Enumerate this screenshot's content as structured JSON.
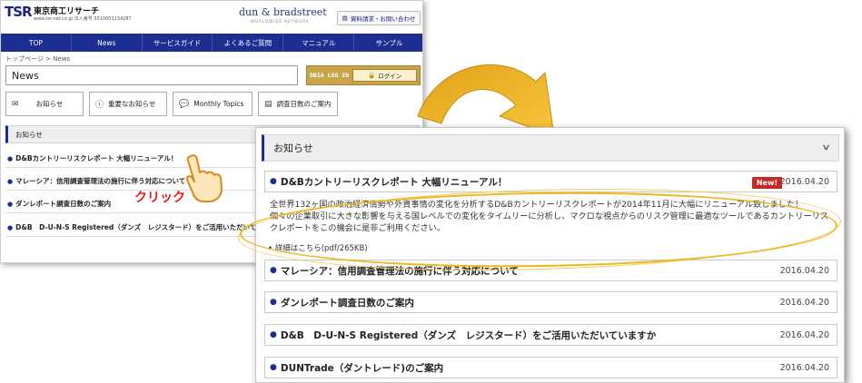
{
  "site": {
    "logo": {
      "mark": "TSR",
      "company": "東京商工リサーチ",
      "sub_line": "www.tsr-net.co.jp 法人番号 5010001134287",
      "dnb_brand": "dun & bradstreet",
      "dnb_sub": "WORLDWIDE NETWORK"
    },
    "inquiry_button": "資料請求・お問い合わせ",
    "nav": [
      "TOP",
      "News",
      "サービスガイド",
      "よくあるご質問",
      "マニュアル",
      "サンプル"
    ],
    "breadcrumb": "トップページ > News",
    "page_heading": "News",
    "login": {
      "tag": "DBIA LOG IN",
      "button": "ログイン"
    },
    "tabs": [
      {
        "icon": "envelope-icon",
        "label": "お知らせ"
      },
      {
        "icon": "warning-icon",
        "label": "重要なお知らせ"
      },
      {
        "icon": "speech-bubble-icon",
        "label": "Monthly Topics"
      },
      {
        "icon": "document-icon",
        "label": "調査日数のご案内"
      }
    ],
    "notice_heading": "お知らせ",
    "notice_items": [
      "D&Bカントリーリスクレポート 大幅リニューアル！",
      "マレーシア：信用調査管理法の施行に伴う対応について",
      "ダンレポート調査日数のご案内",
      "D&B　D-U-N-S Registered（ダンズ　レジスタード）をご活用いただいて"
    ]
  },
  "annotation": {
    "click_label": "クリック"
  },
  "detail": {
    "heading": "お知らせ",
    "featured": {
      "title": "D&Bカントリーリスクレポート 大幅リニューアル！",
      "badge": "New!",
      "date": "2016.04.20",
      "body_line1": "全世界132ヶ国の政治経済情勢や外資事情の変化を分析するD&Bカントリーリスクレポートが2014年11月に大幅にリニューアル致しました！",
      "body_line2": "個々の企業取引に大きな影響を与える国レベルでの変化をタイムリーに分析し、マクロな視点からのリスク管理に最適なツールであるカントリーリス",
      "body_line3": "クレポートをこの機会に是非ご利用ください。",
      "link": "詳細はこちら(pdf/265KB)"
    },
    "items": [
      {
        "title": "マレーシア：信用調査管理法の施行に伴う対応について",
        "date": "2016.04.20"
      },
      {
        "title": "ダンレポート調査日数のご案内",
        "date": "2016.04.20"
      },
      {
        "title": "D&B　D-U-N-S Registered（ダンズ　レジスタード）をご活用いただいていますか",
        "date": "2016.04.20"
      },
      {
        "title": "DUNTrade（ダントレード)のご案内",
        "date": "2016.04.20"
      }
    ]
  },
  "colors": {
    "nav_bg": "#1c2e8f",
    "login_gold": "#c8a44a",
    "new_badge": "#c62828",
    "highlight": "#f0b51f",
    "click_text": "#e21b1b"
  }
}
